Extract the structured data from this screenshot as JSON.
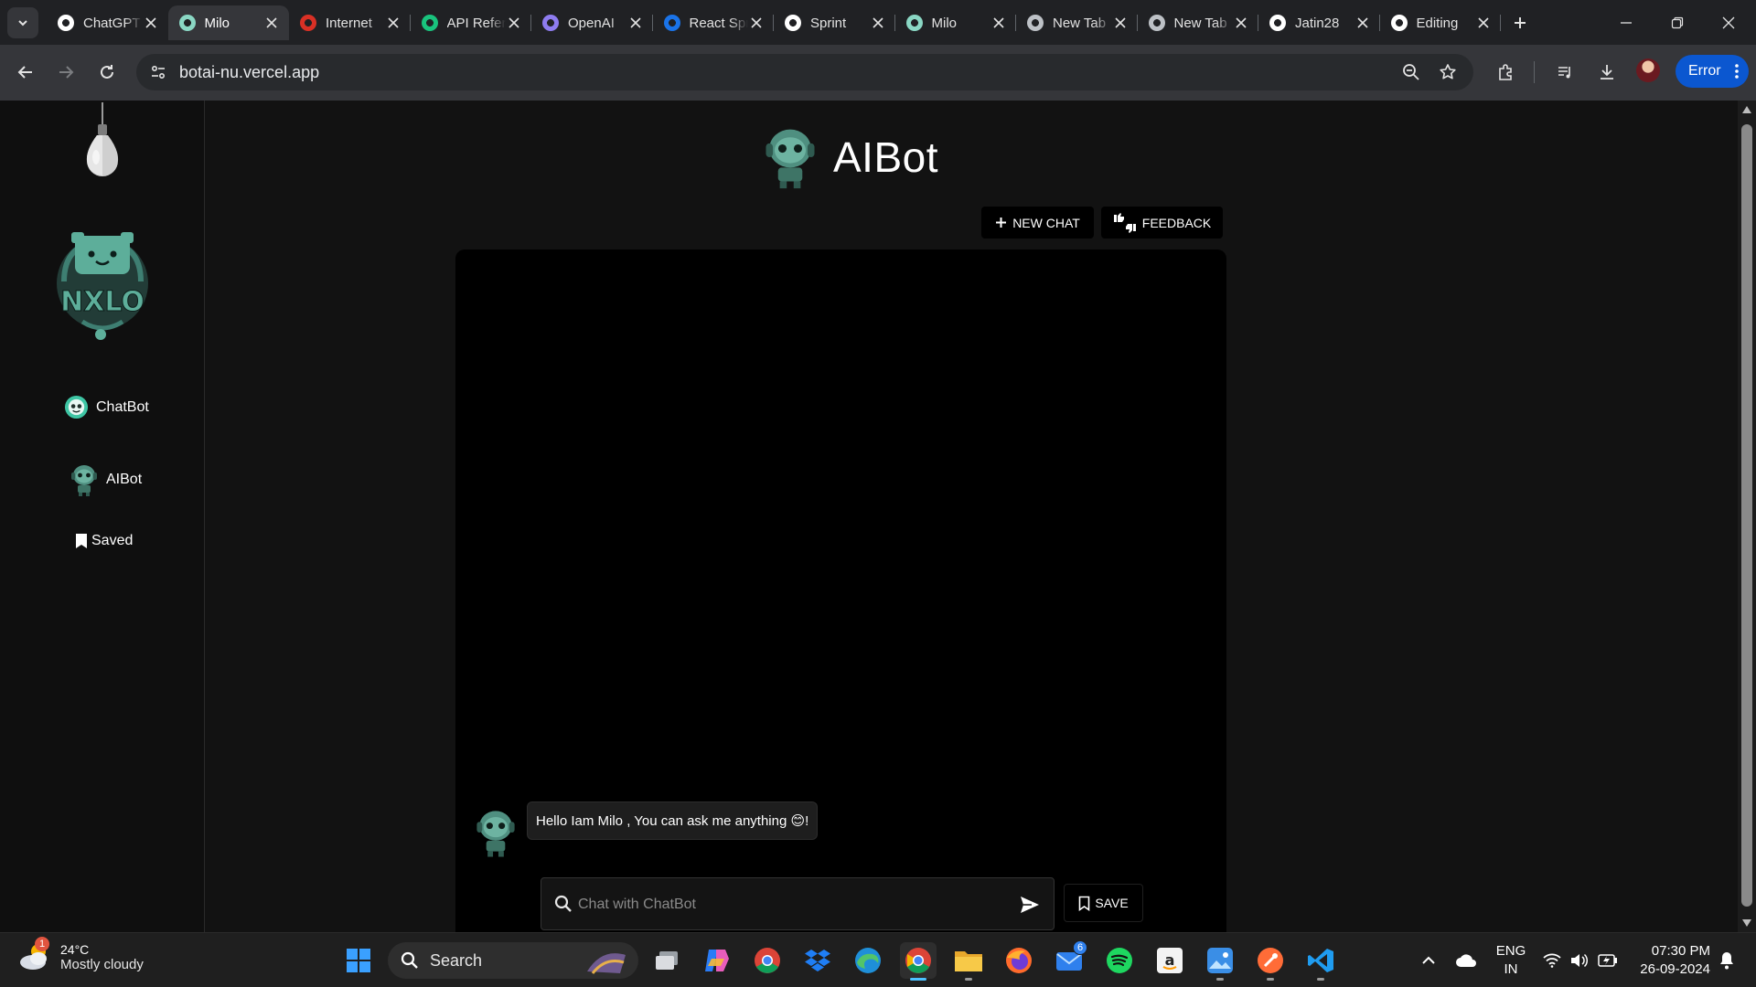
{
  "browser": {
    "tabs": [
      {
        "title": "ChatGPT",
        "favicon": "openai-icon",
        "color": "#ffffff",
        "active": false
      },
      {
        "title": "Milo",
        "favicon": "robot-icon",
        "color": "#8ad7c4",
        "active": true
      },
      {
        "title": "Internet",
        "favicon": "gauge-icon",
        "color": "#d93025",
        "active": false
      },
      {
        "title": "API Reference",
        "favicon": "openai-icon",
        "color": "#19c37d",
        "active": false
      },
      {
        "title": "OpenAI",
        "favicon": "openai-icon",
        "color": "#8e7cf0",
        "active": false
      },
      {
        "title": "React Spring",
        "favicon": "mui-icon",
        "color": "#1a73e8",
        "active": false
      },
      {
        "title": "Sprint",
        "favicon": "shield-icon",
        "color": "#ffffff",
        "active": false
      },
      {
        "title": "Milo",
        "favicon": "robot-icon",
        "color": "#8ad7c4",
        "active": false
      },
      {
        "title": "New Tab",
        "favicon": "chrome-icon",
        "color": "#bdc1c6",
        "active": false
      },
      {
        "title": "New Tab",
        "favicon": "chrome-icon",
        "color": "#bdc1c6",
        "active": false
      },
      {
        "title": "Jatin28",
        "favicon": "github-icon",
        "color": "#ffffff",
        "active": false
      },
      {
        "title": "Editing",
        "favicon": "github-icon",
        "color": "#ffffff",
        "active": false
      }
    ],
    "url": "botai-nu.vercel.app",
    "profile_button": "Error"
  },
  "sidebar": {
    "items": [
      {
        "label": "ChatBot",
        "icon": "chatbot-face-icon"
      },
      {
        "label": "AIBot",
        "icon": "robot-icon"
      },
      {
        "label": "Saved",
        "icon": "bookmark-icon"
      }
    ]
  },
  "main": {
    "title": "AIBot",
    "new_chat_label": "NEW CHAT",
    "feedback_label": "FEEDBACK",
    "message": "Hello Iam Milo , You can ask me anything 😊!",
    "input_placeholder": "Chat with ChatBot",
    "save_label": "SAVE"
  },
  "taskbar": {
    "weather_temp": "24°C",
    "weather_condition": "Mostly cloudy",
    "weather_badge": "1",
    "search_label": "Search",
    "mail_badge": "6",
    "lang_1": "ENG",
    "lang_2": "IN",
    "time": "07:30 PM",
    "date": "26-09-2024"
  },
  "colors": {
    "accent": "#3ec5a4",
    "robot_teal": "#5dae9a",
    "page_bg": "#121212",
    "panel_bg": "#000000",
    "profile_button": "#0b57d0"
  }
}
